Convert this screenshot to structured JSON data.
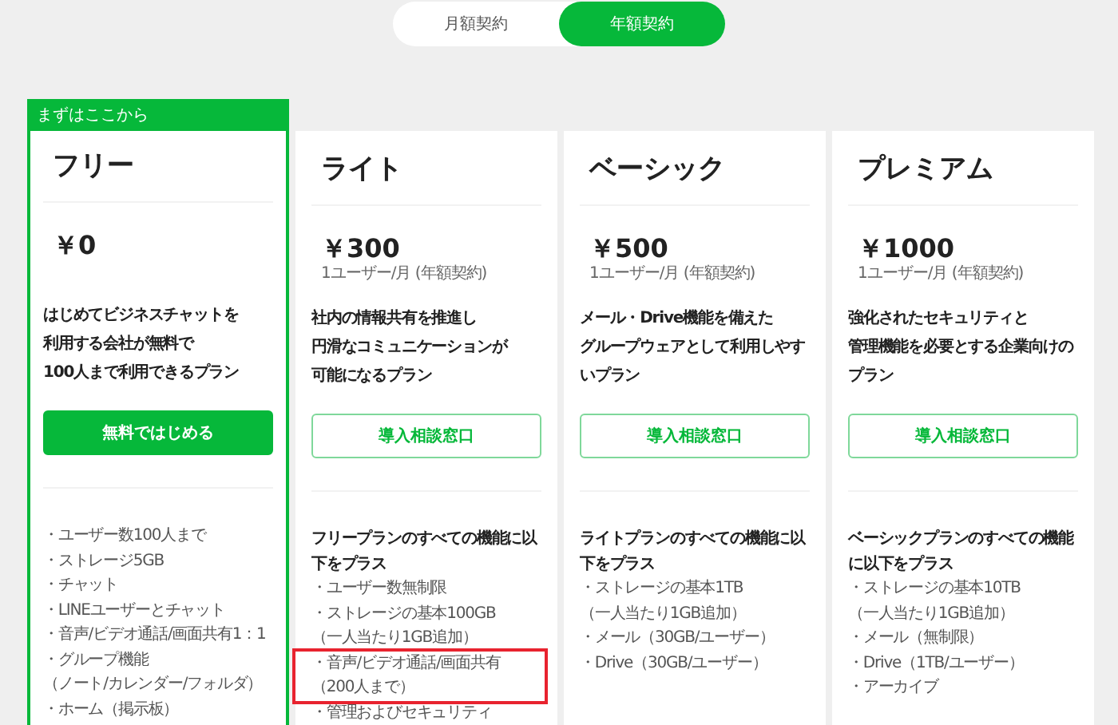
{
  "billing_toggle": [
    {
      "label": "月額契約",
      "selected": false
    },
    {
      "label": "年額契約",
      "selected": true
    }
  ],
  "plans": [
    {
      "badge": "まずはここから",
      "featured": true,
      "name": "フリー",
      "price": "￥0",
      "description_lines": [
        "はじめてビジネスチャットを",
        "利用する会社が無料で",
        "100人まで利用できるプラン"
      ],
      "cta": {
        "label": "無料ではじめる",
        "kind": "filled"
      },
      "feature_groups": [
        {
          "highlighted": false,
          "lines": [
            {
              "kind": "item",
              "text": "・ユーザー数100人まで"
            },
            {
              "kind": "item",
              "text": "・ストレージ5GB"
            },
            {
              "kind": "item",
              "text": "・チャット"
            },
            {
              "kind": "item",
              "text": "・LINEユーザーとチャット"
            },
            {
              "kind": "item",
              "text": "・音声/ビデオ通話/画面共有1：1"
            },
            {
              "kind": "item",
              "text": "・グループ機能"
            },
            {
              "kind": "item",
              "text": "（ノート/カレンダー/フォルダ）"
            },
            {
              "kind": "item",
              "text": "・ホーム（掲示板）"
            }
          ]
        }
      ]
    },
    {
      "featured": false,
      "name": "ライト",
      "price": "￥300",
      "unit": "1ユーザー/月 (年額契約)",
      "description_lines": [
        "社内の情報共有を推進し",
        "円滑なコミュニケーションが",
        "可能になるプラン"
      ],
      "cta": {
        "label": "導入相談窓口",
        "kind": "outline"
      },
      "feature_groups": [
        {
          "highlighted": false,
          "lines": [
            {
              "kind": "lead",
              "text": "フリープランのすべての機能に以下をプラス"
            },
            {
              "kind": "item",
              "text": "・ユーザー数無制限"
            },
            {
              "kind": "item",
              "text": "・ストレージの基本100GB"
            },
            {
              "kind": "item",
              "text": "（一人当たり1GB追加）"
            }
          ]
        },
        {
          "highlighted": true,
          "lines": [
            {
              "kind": "item",
              "text": "・音声/ビデオ通話/画面共有"
            },
            {
              "kind": "item",
              "text": "（200人まで）"
            }
          ]
        },
        {
          "highlighted": false,
          "lines": [
            {
              "kind": "item",
              "text": "・管理およびセキュリティ"
            }
          ]
        }
      ]
    },
    {
      "featured": false,
      "name": "ベーシック",
      "price": "￥500",
      "unit": "1ユーザー/月 (年額契約)",
      "description_lines": [
        "メール・Drive機能を備えた",
        "グループウェアとして利用しやす",
        "いプラン"
      ],
      "cta": {
        "label": "導入相談窓口",
        "kind": "outline"
      },
      "feature_groups": [
        {
          "highlighted": false,
          "lines": [
            {
              "kind": "lead",
              "text": "ライトプランのすべての機能に以下をプラス"
            },
            {
              "kind": "item",
              "text": "・ストレージの基本1TB"
            },
            {
              "kind": "item",
              "text": "（一人当たり1GB追加）"
            },
            {
              "kind": "item",
              "text": "・メール（30GB/ユーザー）"
            },
            {
              "kind": "item",
              "text": "・Drive（30GB/ユーザー）"
            }
          ]
        }
      ]
    },
    {
      "featured": false,
      "name": "プレミアム",
      "price": "￥1000",
      "unit": "1ユーザー/月 (年額契約)",
      "description_lines": [
        "強化されたセキュリティと",
        "管理機能を必要とする企業向けの",
        "プラン"
      ],
      "cta": {
        "label": "導入相談窓口",
        "kind": "outline"
      },
      "feature_groups": [
        {
          "highlighted": false,
          "lines": [
            {
              "kind": "lead",
              "text": "ベーシックプランのすべての機能に以下をプラス"
            },
            {
              "kind": "item",
              "text": "・ストレージの基本10TB"
            },
            {
              "kind": "item",
              "text": "（一人当たり1GB追加）"
            },
            {
              "kind": "item",
              "text": "・メール（無制限）"
            },
            {
              "kind": "item",
              "text": "・Drive（1TB/ユーザー）"
            },
            {
              "kind": "item",
              "text": "・アーカイブ"
            }
          ]
        }
      ]
    }
  ]
}
